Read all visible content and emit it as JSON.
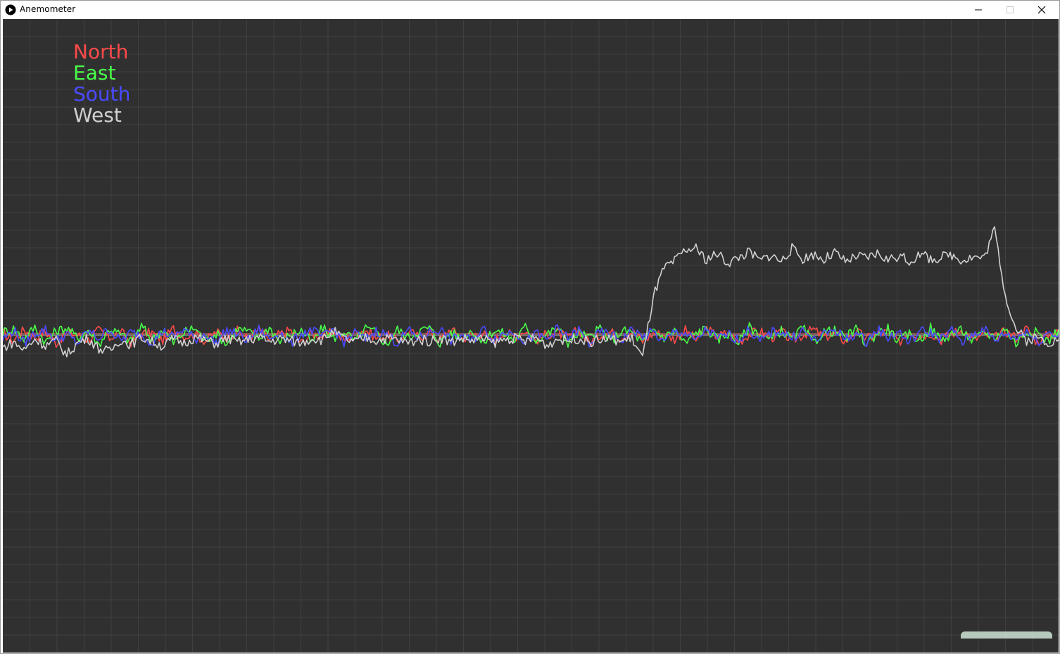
{
  "window": {
    "title": "Anemometer",
    "controls": {
      "minimize": "—",
      "maximize": "☐",
      "close": "✕"
    },
    "icons": {
      "app": "play-circle-icon"
    }
  },
  "legend": [
    {
      "label": "North",
      "color": "#ff4a4a"
    },
    {
      "label": "East",
      "color": "#4aff4a"
    },
    {
      "label": "South",
      "color": "#4a4aff"
    },
    {
      "label": "West",
      "color": "#d0d0d0"
    }
  ],
  "chart_data": {
    "type": "line",
    "grid": true,
    "background": "#303030",
    "gridColor": "#404040",
    "baseline": 0,
    "ylim": [
      -40,
      40
    ],
    "series": [
      {
        "name": "North",
        "color": "#ff4a4a",
        "values": [
          0.3,
          -0.6,
          0.8,
          -0.2,
          0.5,
          -0.9,
          0.4,
          0.1,
          -0.5,
          0.7,
          -0.3,
          0.6,
          -0.8,
          0.2,
          0.4,
          -0.6,
          0.9,
          -0.1,
          0.3,
          -0.7,
          0.5,
          -0.2,
          0.6,
          -0.4,
          0.8,
          -0.5,
          0.2,
          0.7,
          -0.9,
          0.3,
          -0.1,
          0.5,
          -0.6,
          0.4,
          0.8,
          -0.3,
          0.1,
          -0.7,
          0.6,
          -0.2,
          0.4,
          -0.5,
          0.9,
          -0.4,
          0.2,
          0.3,
          -0.8,
          0.5,
          -0.1,
          0.7,
          -0.6,
          0.2,
          0.4,
          -0.3,
          0.8,
          -0.9,
          0.1,
          0.5,
          -0.2,
          0.6,
          -0.7,
          0.3,
          0.2,
          -0.4,
          0.7,
          -0.5,
          0.9,
          -0.1,
          0.4,
          -0.8,
          0.2,
          0.6,
          -0.3,
          0.5,
          -0.6,
          0.1,
          0.8,
          -0.2,
          0.3,
          -0.7,
          0.6,
          -0.4,
          0.2,
          0.5,
          -0.9,
          0.7,
          -0.1,
          0.4,
          -0.5,
          0.3,
          0.8,
          -0.6,
          0.2,
          -0.3,
          0.6,
          -0.2,
          0.9,
          -0.8,
          0.1,
          0.4
        ]
      },
      {
        "name": "East",
        "color": "#4aff4a",
        "values": [
          0.5,
          0.9,
          -0.4,
          1.1,
          -0.8,
          0.6,
          1.0,
          -0.3,
          0.7,
          -1.1,
          0.9,
          0.2,
          -0.7,
          1.2,
          -0.5,
          0.8,
          -0.9,
          0.4,
          1.0,
          -0.6,
          0.3,
          -1.0,
          0.9,
          0.5,
          -0.4,
          1.1,
          -0.8,
          0.2,
          0.7,
          -0.9,
          1.0,
          -0.3,
          0.6,
          -0.7,
          0.9,
          0.4,
          -1.1,
          0.8,
          -0.2,
          0.6,
          1.0,
          -0.9,
          0.5,
          -0.4,
          0.8,
          -1.0,
          0.7,
          0.3,
          -0.6,
          1.1,
          -0.5,
          0.2,
          0.9,
          -0.8,
          0.4,
          -0.3,
          1.0,
          -0.7,
          0.6,
          0.5,
          -0.9,
          0.8,
          -0.2,
          0.7,
          -1.0,
          0.4,
          0.9,
          -0.5,
          0.3,
          -0.8,
          1.1,
          0.2,
          -0.6,
          0.7,
          -0.4,
          1.0,
          -0.9,
          0.5,
          0.6,
          -0.3,
          0.8,
          -1.1,
          0.4,
          0.9,
          -0.7,
          0.2,
          -0.5,
          1.0,
          -0.6,
          0.3,
          0.7,
          -0.8,
          0.5,
          -0.2,
          0.9,
          -1.0,
          0.6,
          0.4,
          -0.7,
          0.8
        ]
      },
      {
        "name": "South",
        "color": "#4a4aff",
        "values": [
          -0.4,
          0.7,
          -0.9,
          0.3,
          0.8,
          -0.6,
          0.2,
          -1.0,
          0.6,
          -0.3,
          0.9,
          -0.7,
          0.4,
          0.1,
          -0.8,
          0.6,
          -0.2,
          0.9,
          -0.5,
          0.3,
          -0.9,
          0.7,
          0.2,
          -0.6,
          0.8,
          -0.4,
          0.5,
          -1.0,
          0.3,
          0.7,
          -0.2,
          0.9,
          -0.8,
          0.4,
          -0.5,
          0.6,
          0.2,
          -0.9,
          0.7,
          -0.3,
          0.5,
          0.8,
          -0.6,
          0.1,
          -0.7,
          0.9,
          -0.4,
          0.3,
          0.6,
          -0.8,
          0.2,
          -0.5,
          0.9,
          -0.3,
          0.7,
          -1.0,
          0.4,
          0.2,
          -0.6,
          0.8,
          -0.2,
          0.5,
          -0.9,
          0.6,
          0.3,
          -0.7,
          0.9,
          -0.4,
          0.2,
          -0.5,
          0.8,
          -0.8,
          0.4,
          0.6,
          -0.3,
          0.7,
          -0.6,
          0.1,
          0.9,
          -0.5,
          0.3,
          -0.7,
          0.8,
          -0.2,
          0.5,
          -0.9,
          0.6,
          0.4,
          -0.4,
          0.7,
          -0.8,
          0.2,
          0.9,
          -0.6,
          0.3,
          -0.3,
          0.7,
          -0.9,
          0.5,
          0.1
        ]
      },
      {
        "name": "West",
        "color": "#d0d0d0",
        "values": [
          -1.5,
          -0.8,
          -1.8,
          -0.4,
          -1.2,
          -0.6,
          -2.4,
          -0.9,
          -0.3,
          -1.6,
          -2.0,
          -0.5,
          -1.1,
          -0.2,
          -0.7,
          -1.3,
          -0.4,
          -0.9,
          -0.2,
          -0.6,
          -1.0,
          -0.3,
          -0.8,
          -0.5,
          -0.2,
          -0.7,
          -0.4,
          -0.6,
          -0.9,
          -0.3,
          -0.5,
          0.6,
          -0.4,
          -0.8,
          -0.2,
          -0.6,
          -0.3,
          -0.5,
          -0.9,
          -0.4,
          -0.7,
          -0.2,
          -0.8,
          -0.3,
          -0.6,
          -0.4,
          -0.9,
          -0.5,
          -0.3,
          -0.7,
          -0.2,
          -1.2,
          -0.4,
          -0.6,
          -0.3,
          -0.8,
          -0.5,
          -0.4,
          -0.7,
          -0.3,
          -2.8,
          5.0,
          8.5,
          9.4,
          10.8,
          11.0,
          9.6,
          10.4,
          9.2,
          9.9,
          10.6,
          9.5,
          10.2,
          9.4,
          11.0,
          9.7,
          10.3,
          9.6,
          10.5,
          9.3,
          10.0,
          9.8,
          10.4,
          9.6,
          10.1,
          9.4,
          10.3,
          9.7,
          9.9,
          10.2,
          9.6,
          10.0,
          9.8,
          13.5,
          5.2,
          0.8,
          -0.6,
          -0.2,
          -0.8,
          -0.5
        ]
      }
    ]
  }
}
